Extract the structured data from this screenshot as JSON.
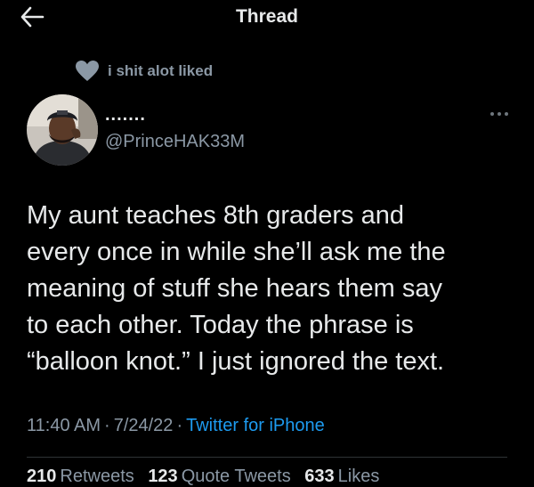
{
  "header": {
    "title": "Thread",
    "back_icon": "arrow-left-icon"
  },
  "social_context": {
    "icon": "heart-icon",
    "text": "i shit alot liked"
  },
  "author": {
    "display_name": ".......",
    "handle": "@PrinceHAK33M",
    "avatar": "profile-photo"
  },
  "tweet": {
    "lines": [
      "My aunt teaches 8th graders and",
      "every once in while she’ll ask me the",
      "meaning of stuff she hears them say",
      "to each other. Today the phrase is",
      "“balloon knot.” I just ignored the text."
    ]
  },
  "meta": {
    "time": "11:40 AM",
    "date": "7/24/22",
    "separator": "·",
    "source": "Twitter for iPhone"
  },
  "stats": {
    "retweets_count": "210",
    "retweets_label": "Retweets",
    "quotes_count": "123",
    "quotes_label": "Quote Tweets",
    "likes_count": "633",
    "likes_label": "Likes"
  },
  "colors": {
    "background": "#000000",
    "text_primary": "#e7e9ea",
    "text_secondary": "#8b98a5",
    "link": "#1d9bf0",
    "divider": "#2f3336"
  }
}
